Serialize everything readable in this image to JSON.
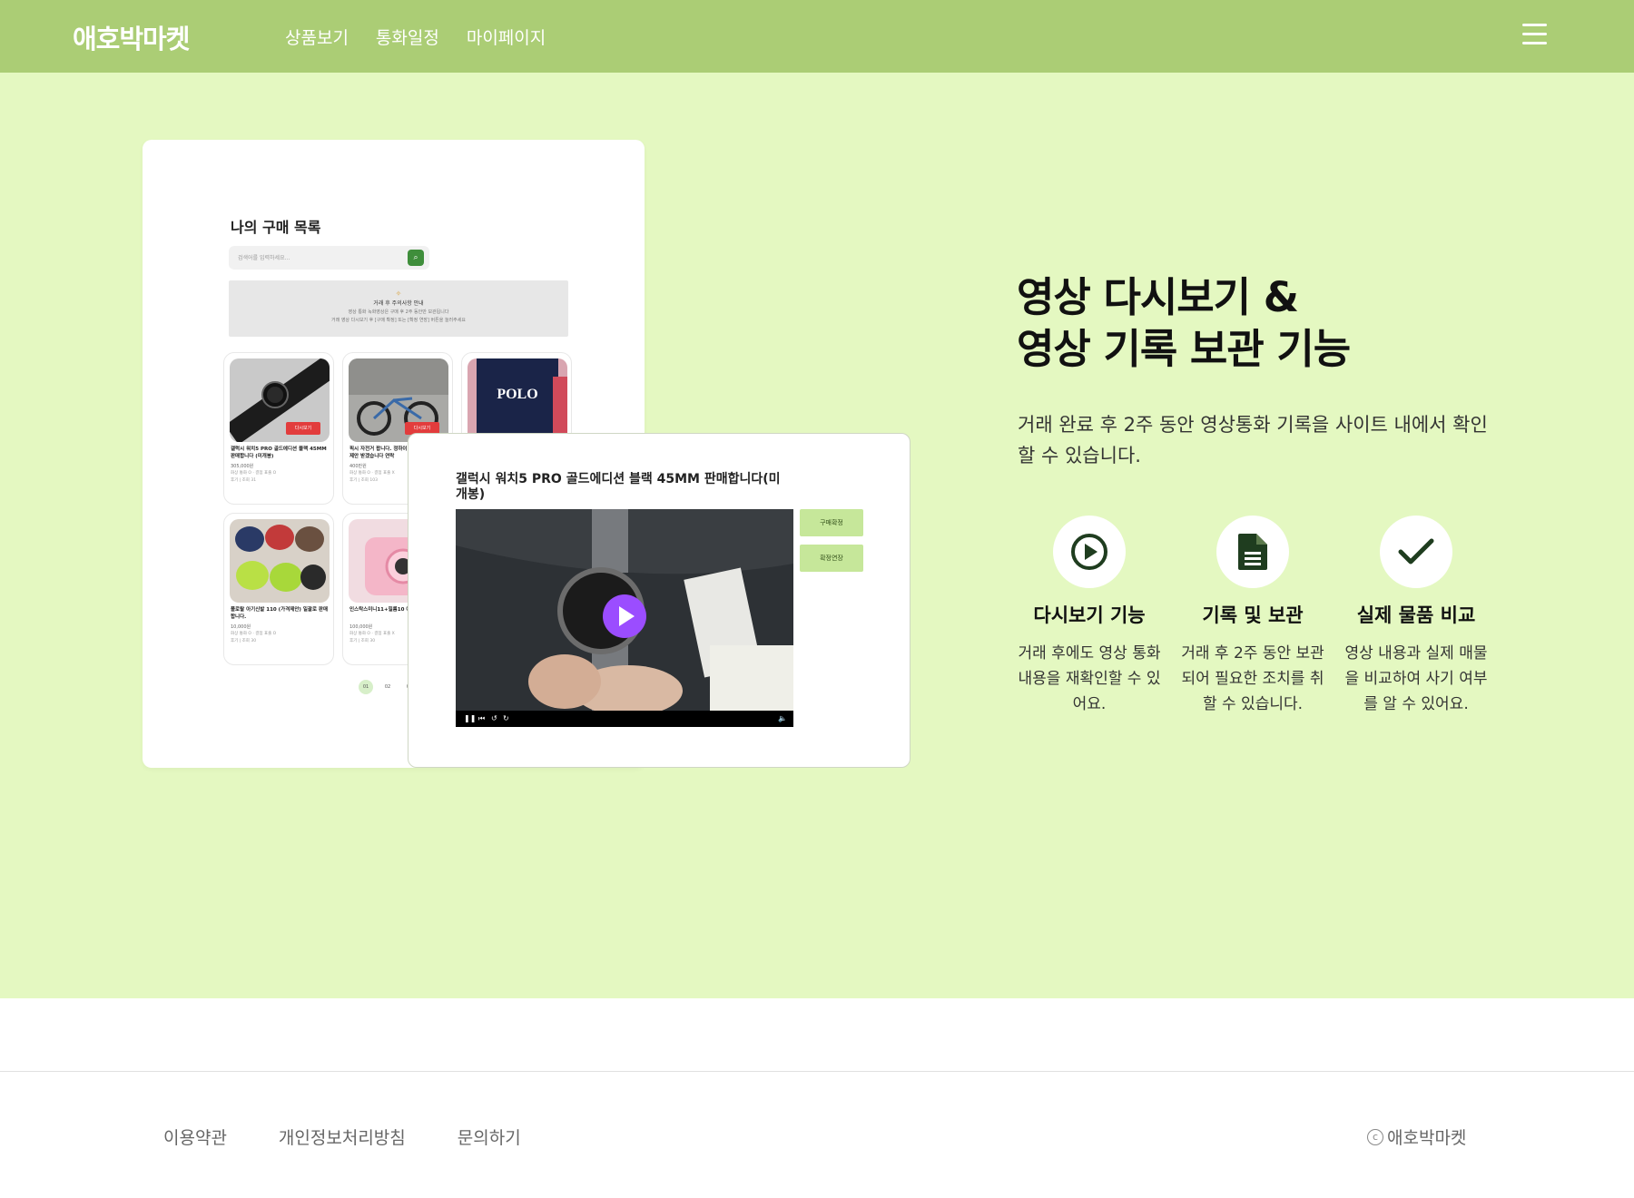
{
  "header": {
    "logo": "애호박마켓",
    "nav": [
      "상품보기",
      "통화일정",
      "마이페이지"
    ],
    "menu_icon": "hamburger-menu-icon"
  },
  "mockup_list": {
    "title": "나의 구매 목록",
    "search_placeholder": "검색어를 입력하세요...",
    "notice_title": "거래 후 주의사항 안내",
    "notice_lines": [
      "영상 통화 녹화영상은 구매 후 2주 동안만 보관됩니다",
      "거래 영상 다시보기 후 [구매 확정] 또는 [확정 연장] 버튼을 눌러주세요"
    ],
    "products": [
      {
        "badge": "다시보기",
        "title": "갤럭시 워치5 PRO 골드에디션 블랙 45MM 판매합니다 (미개봉)",
        "price": "305,000원",
        "meta": "화상 통화 O · 결점 표출 O",
        "meta2": "후기 | 조회 31"
      },
      {
        "badge": "다시보기",
        "title": "픽시 자전거 팝니다. 정하이 사고 최고급 라서 제안 받겠습니다 연락",
        "price": "400만원",
        "meta": "화상 통화 O · 결점 표출 X",
        "meta2": "후기 | 조회 103"
      },
      {
        "badge": "",
        "title": "",
        "price": "",
        "meta": "",
        "meta2": ""
      },
      {
        "badge": "",
        "title": "폴로랄 아기신발 110 (가격제안) 일괄로 판매합니다.",
        "price": "10,000원",
        "meta": "화상 통화 O · 결점 표출 O",
        "meta2": "후기 | 조회 30"
      },
      {
        "badge": "",
        "title": "인스탁스미니11+필름10 이드",
        "price": "100,000원",
        "meta": "화상 통화 O · 결점 표출 X",
        "meta2": "후기 | 조회 30"
      }
    ],
    "pager": [
      "01",
      "02",
      "03"
    ]
  },
  "mockup_video": {
    "title": "갤럭시 워치5 PRO 골드에디션 블랙 45MM 판매합니다(미개봉)",
    "buttons": [
      "구매확정",
      "확정연장"
    ],
    "controls": [
      "pause-icon",
      "skip-icon",
      "rewind-icon",
      "forward-icon",
      "volume-icon"
    ]
  },
  "hero": {
    "headline_line1": "영상 다시보기 &",
    "headline_line2": "영상 기록 보관 기능",
    "description": "거래 완료 후 2주 동안 영상통화 기록을 사이트 내에서 확인할 수 있습니다.",
    "features": [
      {
        "icon": "play-circle-icon",
        "title": "다시보기 기능",
        "desc": "거래 후에도 영상 통화 내용을 재확인할 수 있어요."
      },
      {
        "icon": "document-icon",
        "title": "기록 및 보관",
        "desc": "거래 후 2주 동안 보관되어 필요한 조치를 취할 수 있습니다."
      },
      {
        "icon": "checkmark-icon",
        "title": "실제 물품 비교",
        "desc": "영상 내용과 실제 매물을 비교하여 사기 여부를 알 수 있어요."
      }
    ]
  },
  "footer": {
    "links": [
      "이용약관",
      "개인정보처리방침",
      "문의하기"
    ],
    "copyright_symbol": "c",
    "copyright": "애호박마켓"
  },
  "colors": {
    "header_bg": "#abcd75",
    "hero_bg": "#e4f8c1",
    "accent_button": "#c6e79a",
    "play_button": "#9b4dff"
  }
}
